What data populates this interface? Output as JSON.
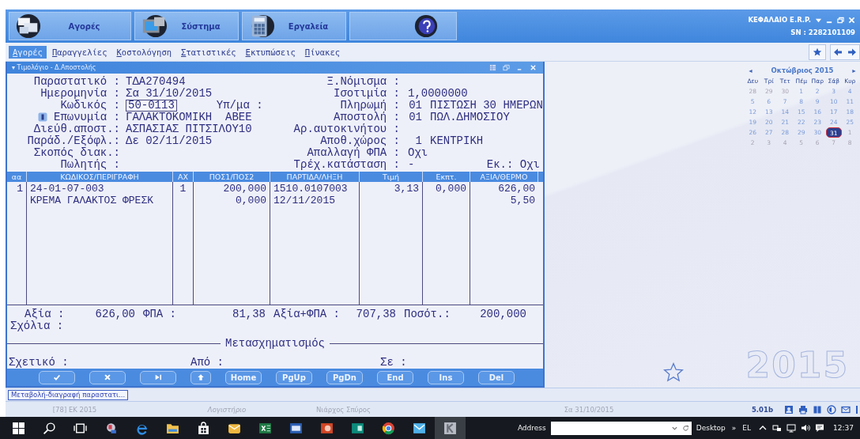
{
  "header": {
    "buttons": [
      {
        "kind": "documents",
        "label": "Αγορές"
      },
      {
        "kind": "monitor",
        "label": "Σύστημα"
      },
      {
        "kind": "calculator",
        "label": "Εργαλεία"
      },
      {
        "kind": "help"
      }
    ],
    "app_title": "ΚΕΦΑΛΑΙΟ E.R.P.",
    "serial": "SN : 2282101109"
  },
  "menu": [
    {
      "label": "Αγορές",
      "selected": true
    },
    {
      "label": "Παραγγελίες",
      "selected": false
    },
    {
      "label": "Κοστολόγηση",
      "selected": false
    },
    {
      "label": "Στατιστικές",
      "selected": false
    },
    {
      "label": "Εκτυπώσεις",
      "selected": false
    },
    {
      "label": "Πίνακες",
      "selected": false
    }
  ],
  "form": {
    "title": "▾ Τιμολόγιο - Δ.Αποστολής",
    "rows": [
      {
        "kind": "plain",
        "label": "Παραστατικό :",
        "value": "ΤΔΑ270494",
        "label2": "Ξ.Νόμισμα :"
      },
      {
        "kind": "plain",
        "label": "Ημερομηνία :",
        "value": "Σα 31/10/2015",
        "label2": "Ισοτιμία :",
        "value2": "1,0000000"
      },
      {
        "kind": "input",
        "label": "Κωδικός :",
        "value": "50-0113",
        "middle": "Υπ/μα :",
        "label2": "Πληρωμή :",
        "code2": "01",
        "value2": "ΠΙΣΤΩΣΗ 30 ΗΜΕΡΩΝ"
      },
      {
        "kind": "lookup",
        "label": "Επωνυμία :",
        "value": "ΓΑΛΑΚΤΟΚΟΜΙΚΗ  ΑΒΕΕ",
        "label2": "Αποστολή :",
        "code2": "01",
        "value2": "ΠΩΛ.ΔΗΜΟΣΙΟΥ"
      },
      {
        "kind": "plain",
        "label": "Διεύθ.αποστ.:",
        "value": "ΑΣΠΑΣΙΑΣ ΠΙΤΣΙΛΟΥ10",
        "label2": "Αρ.αυτοκινήτου :"
      },
      {
        "kind": "plain",
        "label": "Παράδ./Εξόφλ.:",
        "value": "Δε 02/11/2015",
        "label2": "Αποθ.χώρος :",
        "code2": "1",
        "value2": "ΚΕΝΤΡΙΚΗ"
      },
      {
        "kind": "plain",
        "label": "Σκοπός διακ.:",
        "label2": "Απαλλαγή ΦΠΑ :",
        "value2": "Οχι"
      },
      {
        "kind": "plain",
        "label": "Πωλητής :",
        "label2": "Τρέχ.κατάσταση :",
        "value2": "-",
        "extra": "Εκ.: Οχι"
      }
    ]
  },
  "table": {
    "columns": [
      "αα",
      "ΚΩΔΙΚΟΣ/ΠΕΡΙΓΡΑΦΗ",
      "ΑΧ",
      "ΠΟΣ1/ΠΟΣ2",
      "ΠΑΡΤΙΔΑ/ΛΗΞΗ",
      "Τιμή",
      "Εκπτ.",
      "ΑΞΙΑ/ΘΕΡΜΟ"
    ],
    "rows": [
      [
        "1",
        "24-01-07-003",
        "1",
        "200,000",
        "1510.0107003",
        "3,13",
        "0,000",
        "626,00"
      ],
      [
        null,
        "ΚΡΕΜΑ ΓΑΛΑΚΤΟΣ ΦΡΕΣΚ",
        null,
        "0,000",
        "12/11/2015",
        null,
        null,
        "5,50"
      ]
    ]
  },
  "totals": [
    {
      "label": "Αξία :",
      "value": "626,00"
    },
    {
      "label": "ΦΠΑ :",
      "value": "81,38"
    },
    {
      "label": "Αξία+ΦΠΑ :",
      "value": "707,38"
    },
    {
      "label": "Ποσότ.:",
      "value": "200,000"
    }
  ],
  "comments_label": "Σχόλια :",
  "transform": {
    "title": "Μετασχηματισμός",
    "fields": [
      "Σχετικό :",
      "Από :",
      "Σε :"
    ]
  },
  "buttons": [
    {
      "kind": "confirm"
    },
    {
      "kind": "cancel"
    },
    {
      "kind": "last"
    },
    {
      "kind": "up"
    },
    {
      "kind": "text",
      "label": "Home"
    },
    {
      "kind": "text",
      "label": "PgUp"
    },
    {
      "kind": "text",
      "label": "PgDn"
    },
    {
      "kind": "text",
      "label": "End"
    },
    {
      "kind": "text",
      "label": "Ins"
    },
    {
      "kind": "text",
      "label": "Del"
    }
  ],
  "calendar": {
    "prev": "◄",
    "month": "Οκτώβριος 2015",
    "next": "►",
    "weekdays": [
      "Δευ",
      "Τρί",
      "Τετ",
      "Πέμ",
      "Παρ",
      "Σάβ",
      "Κυρ"
    ],
    "weeks": [
      [
        {
          "d": "28",
          "out": true,
          "selected": false
        },
        {
          "d": "29",
          "out": true,
          "selected": false
        },
        {
          "d": "30",
          "out": true,
          "selected": false
        },
        {
          "d": "1",
          "out": false,
          "selected": false
        },
        {
          "d": "2",
          "out": false,
          "selected": false
        },
        {
          "d": "3",
          "out": false,
          "selected": false
        },
        {
          "d": "4",
          "out": false,
          "selected": false
        }
      ],
      [
        {
          "d": "5",
          "out": false,
          "selected": false
        },
        {
          "d": "6",
          "out": false,
          "selected": false
        },
        {
          "d": "7",
          "out": false,
          "selected": false
        },
        {
          "d": "8",
          "out": false,
          "selected": false
        },
        {
          "d": "9",
          "out": false,
          "selected": false
        },
        {
          "d": "10",
          "out": false,
          "selected": false
        },
        {
          "d": "11",
          "out": false,
          "selected": false
        }
      ],
      [
        {
          "d": "12",
          "out": false,
          "selected": false
        },
        {
          "d": "13",
          "out": false,
          "selected": false
        },
        {
          "d": "14",
          "out": false,
          "selected": false
        },
        {
          "d": "15",
          "out": false,
          "selected": false
        },
        {
          "d": "16",
          "out": false,
          "selected": false
        },
        {
          "d": "17",
          "out": false,
          "selected": false
        },
        {
          "d": "18",
          "out": false,
          "selected": false
        }
      ],
      [
        {
          "d": "19",
          "out": false,
          "selected": false
        },
        {
          "d": "20",
          "out": false,
          "selected": false
        },
        {
          "d": "21",
          "out": false,
          "selected": false
        },
        {
          "d": "22",
          "out": false,
          "selected": false
        },
        {
          "d": "23",
          "out": false,
          "selected": false
        },
        {
          "d": "24",
          "out": false,
          "selected": false
        },
        {
          "d": "25",
          "out": false,
          "selected": false
        }
      ],
      [
        {
          "d": "26",
          "out": false,
          "selected": false
        },
        {
          "d": "27",
          "out": false,
          "selected": false
        },
        {
          "d": "28",
          "out": false,
          "selected": false
        },
        {
          "d": "29",
          "out": false,
          "selected": false
        },
        {
          "d": "30",
          "out": false,
          "selected": false
        },
        {
          "d": "31",
          "out": false,
          "selected": true
        },
        {
          "d": "1",
          "out": true,
          "selected": false
        }
      ],
      [
        {
          "d": "2",
          "out": true,
          "selected": false
        },
        {
          "d": "3",
          "out": true,
          "selected": false
        },
        {
          "d": "4",
          "out": true,
          "selected": false
        },
        {
          "d": "5",
          "out": true,
          "selected": false
        },
        {
          "d": "6",
          "out": true,
          "selected": false
        },
        {
          "d": "7",
          "out": true,
          "selected": false
        },
        {
          "d": "8",
          "out": true,
          "selected": false
        }
      ]
    ]
  },
  "year": "2015",
  "task": "Μεταβολή-διαγραφή παραστατι...",
  "status": {
    "cells": [
      "[78] ΕΚ 2015",
      "Λογιστήριο",
      "Νιάρχος Σπύρος",
      "Σα 31/10/2015"
    ],
    "version": "5.01b",
    "icons": [
      {
        "kind": "users"
      },
      {
        "kind": "printer"
      },
      {
        "kind": "book"
      },
      {
        "kind": "globe"
      },
      {
        "kind": "mail"
      },
      {
        "kind": "more"
      }
    ]
  },
  "taskbar": {
    "apps": [
      {
        "kind": "start"
      },
      {
        "kind": "search"
      },
      {
        "kind": "taskview"
      },
      {
        "kind": "app"
      },
      {
        "kind": "browser"
      },
      {
        "kind": "folder"
      },
      {
        "kind": "store"
      },
      {
        "kind": "mail"
      },
      {
        "kind": "sheet"
      },
      {
        "kind": "doc"
      },
      {
        "kind": "slides"
      },
      {
        "kind": "publisher"
      },
      {
        "kind": "globe"
      },
      {
        "kind": "envelope"
      },
      {
        "kind": "tile"
      }
    ],
    "address_label": "Address",
    "desktop_label": "Desktop",
    "chevron": "»",
    "language": "EL",
    "tray": [
      {
        "kind": "up"
      },
      {
        "kind": "network"
      },
      {
        "kind": "monitor"
      },
      {
        "kind": "volume"
      },
      {
        "kind": "message"
      }
    ],
    "time": "12:37"
  }
}
